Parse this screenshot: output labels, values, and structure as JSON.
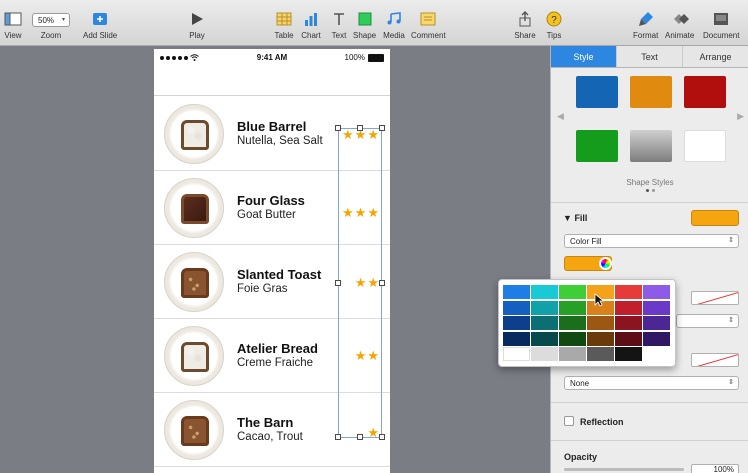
{
  "toolbar": {
    "view_label": "View",
    "zoom_value": "50%",
    "zoom_label": "Zoom",
    "add_slide_label": "Add Slide",
    "play_label": "Play",
    "table_label": "Table",
    "chart_label": "Chart",
    "text_label": "Text",
    "shape_label": "Shape",
    "media_label": "Media",
    "comment_label": "Comment",
    "share_label": "Share",
    "tips_label": "Tips",
    "format_label": "Format",
    "animate_label": "Animate",
    "document_label": "Document"
  },
  "phone": {
    "status_time": "9:41 AM",
    "status_battery": "100%",
    "rows": [
      {
        "title": "Blue Barrel",
        "subtitle": "Nutella, Sea Salt",
        "stars": "★★★",
        "bread": "white"
      },
      {
        "title": "Four Glass",
        "subtitle": "Goat Butter",
        "stars": "★★★",
        "bread": "choc"
      },
      {
        "title": "Slanted Toast",
        "subtitle": "Foie Gras",
        "stars": "★★",
        "bread": "grain"
      },
      {
        "title": "Atelier Bread",
        "subtitle": "Creme Fraiche",
        "stars": "★★",
        "bread": "white"
      },
      {
        "title": "The Barn",
        "subtitle": "Cacao, Trout",
        "stars": "★",
        "bread": "grain"
      }
    ]
  },
  "inspector": {
    "tabs": [
      "Style",
      "Text",
      "Arrange"
    ],
    "active_tab": "Style",
    "shape_style_colors": [
      "#1565b5",
      "#e08a10",
      "#b10e0e",
      "#169c1c",
      "#9a9a9a",
      "#ffffff"
    ],
    "shape_styles_label": "Shape Styles",
    "fill_label": "Fill",
    "fill_type": "Color Fill",
    "border_style": "None",
    "reflection_label": "Reflection",
    "opacity_label": "Opacity",
    "opacity_value": "100%"
  },
  "palette": {
    "colors": [
      [
        "#1e7ee6",
        "#1ac9d6",
        "#3ecf37",
        "#f3a21a",
        "#e63b3b",
        "#8e5ae8"
      ],
      [
        "#145fbf",
        "#11a1a8",
        "#26a126",
        "#d9801a",
        "#c21f2c",
        "#6b39c7"
      ],
      [
        "#0d3f8c",
        "#0b6f73",
        "#1b6e1b",
        "#9c5712",
        "#8a1420",
        "#4c2695"
      ],
      [
        "#082a5f",
        "#074a4c",
        "#104a10",
        "#6a3a0b",
        "#5c0d15",
        "#311864"
      ],
      [
        "#ffffff",
        "#dcdcdc",
        "#a9a9a9",
        "#5a5a5a",
        "#141414",
        "#ffffff"
      ]
    ]
  }
}
